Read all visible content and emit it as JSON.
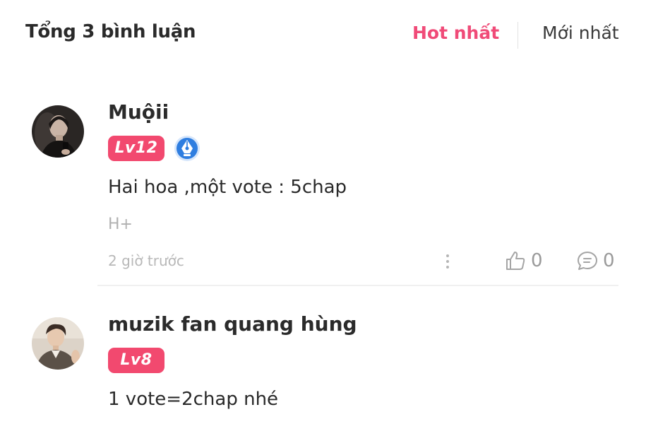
{
  "header": {
    "total_label": "Tổng 3 bình luận",
    "sort_hot": "Hot nhất",
    "sort_new": "Mới nhất",
    "active_sort_color": "#f04b78"
  },
  "comments": [
    {
      "username": "Muộii",
      "level": "Lv12",
      "has_author_badge": true,
      "text": "Hai hoa ,một vote : 5chap",
      "chapter": "H+",
      "time": "2 giờ trước",
      "likes": "0",
      "replies": "0"
    },
    {
      "username": "muzik fan quang hùng",
      "level": "Lv8",
      "has_author_badge": false,
      "text": "1 vote=2chap nhé"
    }
  ],
  "colors": {
    "level_badge": "#f2496f",
    "author_badge": "#2f7ee0"
  },
  "icons": {
    "like": "thumbs-up-icon",
    "reply": "comment-bubble-icon",
    "more": "more-vertical-icon",
    "author": "pen-nib-badge-icon"
  }
}
